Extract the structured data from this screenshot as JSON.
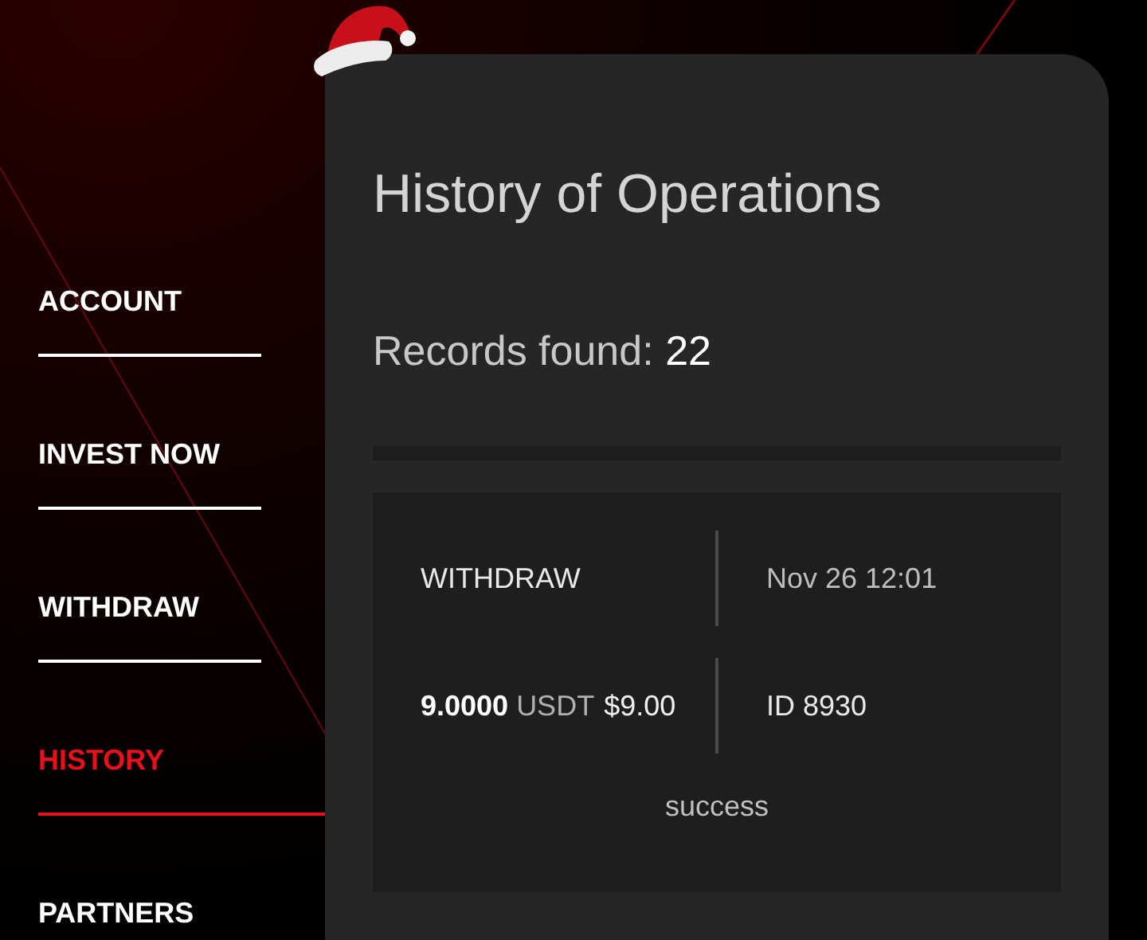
{
  "nav": [
    {
      "label": "ACCOUNT",
      "selected": false
    },
    {
      "label": "INVEST NOW",
      "selected": false
    },
    {
      "label": "WITHDRAW",
      "selected": false
    },
    {
      "label": "HISTORY",
      "selected": true
    },
    {
      "label": "PARTNERS",
      "selected": false
    }
  ],
  "panel": {
    "title": "History of Operations",
    "records_label": "Records found:",
    "records_count": "22",
    "operations": [
      {
        "type": "WITHDRAW",
        "datetime": "Nov 26 12:01",
        "amount": "9.0000",
        "currency": "USDT",
        "usd": "$9.00",
        "id": "ID 8930",
        "status": "success"
      }
    ]
  }
}
